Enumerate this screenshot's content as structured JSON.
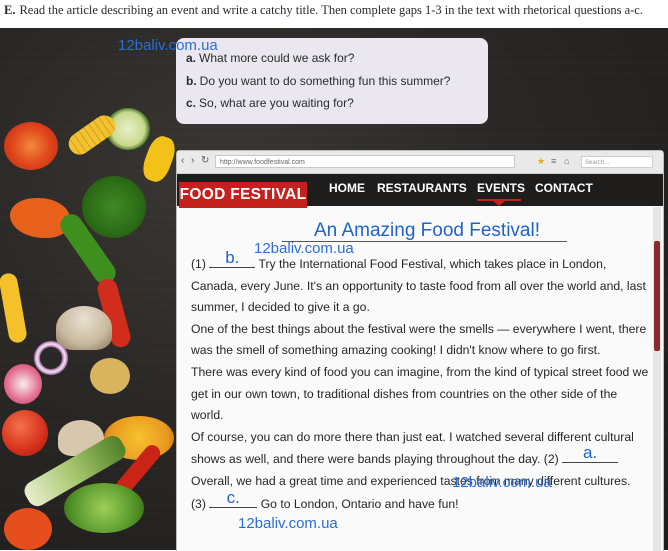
{
  "instruction": {
    "letter": "E.",
    "text": "Read the article describing an event and write a catchy title. Then complete gaps 1-3 in the text with rhetorical questions a-c."
  },
  "questions": [
    {
      "letter": "a.",
      "text": "What more could we ask for?"
    },
    {
      "letter": "b.",
      "text": "Do you want to do something fun this summer?"
    },
    {
      "letter": "c.",
      "text": "So, what are you waiting for?"
    }
  ],
  "browser": {
    "url": "http://www.foodfestival.com",
    "search_placeholder": "Search..."
  },
  "site": {
    "logo": "FOOD FESTIVAL",
    "menu": [
      "HOME",
      "RESTAURANTS",
      "EVENTS",
      "CONTACT"
    ],
    "active_menu": "EVENTS",
    "accent": "#c4201d"
  },
  "article": {
    "title": "An Amazing Food Festival!",
    "gap1_num": "(1)",
    "gap1_answer": "b.",
    "p1_rest": "Try the International Food Festival, which takes place in London, Canada, every June. It's an opportunity to taste food from all over the world and, last summer, I decided to give it a go.",
    "p2": "One of the best things about the festival were the smells — everywhere I went, there was the smell of something amazing cooking! I didn't know where to go first.",
    "p3": "There was every kind of food you can imagine, from the kind of typical street food we get in our own town, to traditional dishes from countries on the other side of the world.",
    "p4_before": "Of course, you can do more there than just eat. I watched several different cultural shows as well, and there were bands playing throughout the day.",
    "gap2_num": "(2)",
    "gap2_answer": "a.",
    "p5": "Overall, we had a great time and experienced tastes from many different cultures.",
    "gap3_num": "(3)",
    "gap3_answer": "c.",
    "p6_rest": "Go to London, Ontario and have fun!"
  },
  "watermarks": [
    "12baliv.com.ua",
    "12baliv.com.ua",
    "12baliv.com.ua",
    "12baliv.com.ua"
  ],
  "answer_color": "#1f63c8"
}
